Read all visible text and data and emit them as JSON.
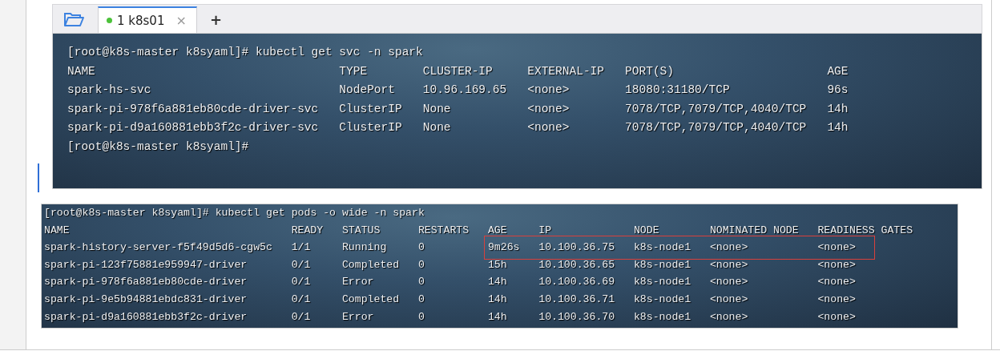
{
  "tab_bar": {
    "tabs": [
      {
        "label": "1 k8s01",
        "selected": true,
        "connected": true
      }
    ],
    "close_glyph": "×",
    "new_tab_button": "+"
  },
  "svc_terminal": {
    "command_line": "[root@k8s-master k8syaml]# kubectl get svc -n spark",
    "columns": [
      "NAME",
      "TYPE",
      "CLUSTER-IP",
      "EXTERNAL-IP",
      "PORT(S)",
      "AGE"
    ],
    "rows": [
      {
        "cells": [
          "spark-hs-svc",
          "NodePort",
          "10.96.169.65",
          "<none>",
          "18080:31180/TCP",
          "96s"
        ]
      },
      {
        "cells": [
          "spark-pi-978f6a881eb80cde-driver-svc",
          "ClusterIP",
          "None",
          "<none>",
          "7078/TCP,7079/TCP,4040/TCP",
          "14h"
        ]
      },
      {
        "cells": [
          "spark-pi-d9a160881ebb3f2c-driver-svc",
          "ClusterIP",
          "None",
          "<none>",
          "7078/TCP,7079/TCP,4040/TCP",
          "14h"
        ]
      }
    ],
    "final_prompt": "[root@k8s-master k8syaml]#"
  },
  "pods_terminal": {
    "command_line": "[root@k8s-master k8syaml]# kubectl get pods -o wide -n spark",
    "columns": [
      "NAME",
      "READY",
      "STATUS",
      "RESTARTS",
      "AGE",
      "IP",
      "NODE",
      "NOMINATED NODE",
      "READINESS GATES"
    ],
    "rows": [
      {
        "cells": [
          "spark-history-server-f5f49d5d6-cgw5c",
          "1/1",
          "Running",
          "0",
          "9m26s",
          "10.100.36.75",
          "k8s-node1",
          "<none>",
          "<none>"
        ],
        "highlighted": true
      },
      {
        "cells": [
          "spark-pi-123f75881e959947-driver",
          "0/1",
          "Completed",
          "0",
          "15h",
          "10.100.36.65",
          "k8s-node1",
          "<none>",
          "<none>"
        ],
        "highlighted": false
      },
      {
        "cells": [
          "spark-pi-978f6a881eb80cde-driver",
          "0/1",
          "Error",
          "0",
          "14h",
          "10.100.36.69",
          "k8s-node1",
          "<none>",
          "<none>"
        ],
        "highlighted": false
      },
      {
        "cells": [
          "spark-pi-9e5b94881ebdc831-driver",
          "0/1",
          "Completed",
          "0",
          "14h",
          "10.100.36.71",
          "k8s-node1",
          "<none>",
          "<none>"
        ],
        "highlighted": false
      },
      {
        "cells": [
          "spark-pi-d9a160881ebb3f2c-driver",
          "0/1",
          "Error",
          "0",
          "14h",
          "10.100.36.70",
          "k8s-node1",
          "<none>",
          "<none>"
        ],
        "highlighted": false
      }
    ]
  }
}
